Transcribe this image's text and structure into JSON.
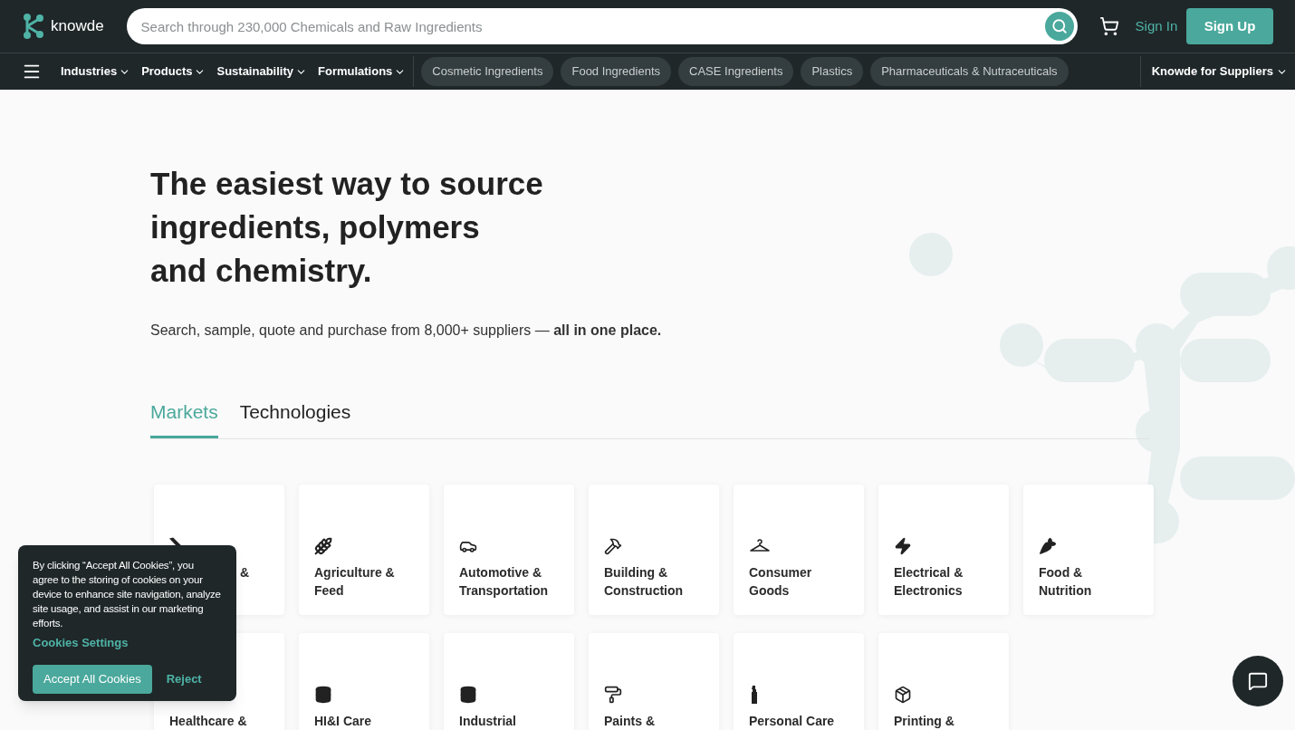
{
  "header": {
    "logo_text": "knowde",
    "search": {
      "placeholder": "Search through 230,000 Chemicals and Raw Ingredients"
    },
    "sign_in": "Sign In",
    "sign_up": "Sign Up"
  },
  "nav": {
    "menus": [
      {
        "label": "Industries"
      },
      {
        "label": "Products"
      },
      {
        "label": "Sustainability"
      },
      {
        "label": "Formulations"
      }
    ],
    "pills": [
      {
        "label": "Cosmetic Ingredients"
      },
      {
        "label": "Food Ingredients"
      },
      {
        "label": "CASE Ingredients"
      },
      {
        "label": "Plastics"
      },
      {
        "label": "Pharmaceuticals & Nutraceuticals"
      }
    ],
    "suppliers": "Knowde for Suppliers"
  },
  "hero": {
    "title_lines": [
      "The easiest way to source",
      "ingredients, polymers",
      "and chemistry."
    ],
    "subtitle": "Search, sample, quote and purchase from 8,000+ suppliers — **all in one place.**"
  },
  "tabs": [
    {
      "label": "Markets",
      "selected": true
    },
    {
      "label": "Technologies",
      "selected": false
    }
  ],
  "markets": [
    {
      "label": "&",
      "kind": "covered"
    },
    {
      "label": "Agriculture & Feed",
      "kind": "full"
    },
    {
      "label": "Automotive & Transportation",
      "kind": "full"
    },
    {
      "label": "Building & Construction",
      "kind": "full"
    },
    {
      "label": "Consumer Goods",
      "kind": "full"
    },
    {
      "label": "Electrical & Electronics",
      "kind": "full"
    },
    {
      "label": "Food & Nutrition",
      "kind": "full"
    },
    {
      "label": "Healthcare &",
      "kind": "full"
    },
    {
      "label": "HI&I Care",
      "kind": "full"
    },
    {
      "label": "Industrial",
      "kind": "full"
    },
    {
      "label": "Paints &",
      "kind": "full"
    },
    {
      "label": "Personal Care",
      "kind": "full"
    },
    {
      "label": "Printing &",
      "kind": "full"
    }
  ],
  "cookie_banner": {
    "text": "By clicking “Accept All Cookies”, you agree to the storing of cookies on your device to enhance site navigation, analyze site usage, and assist in our marketing efforts.",
    "settings_link": "Cookies Settings",
    "accept": "Accept All Cookies",
    "reject": "Reject"
  }
}
